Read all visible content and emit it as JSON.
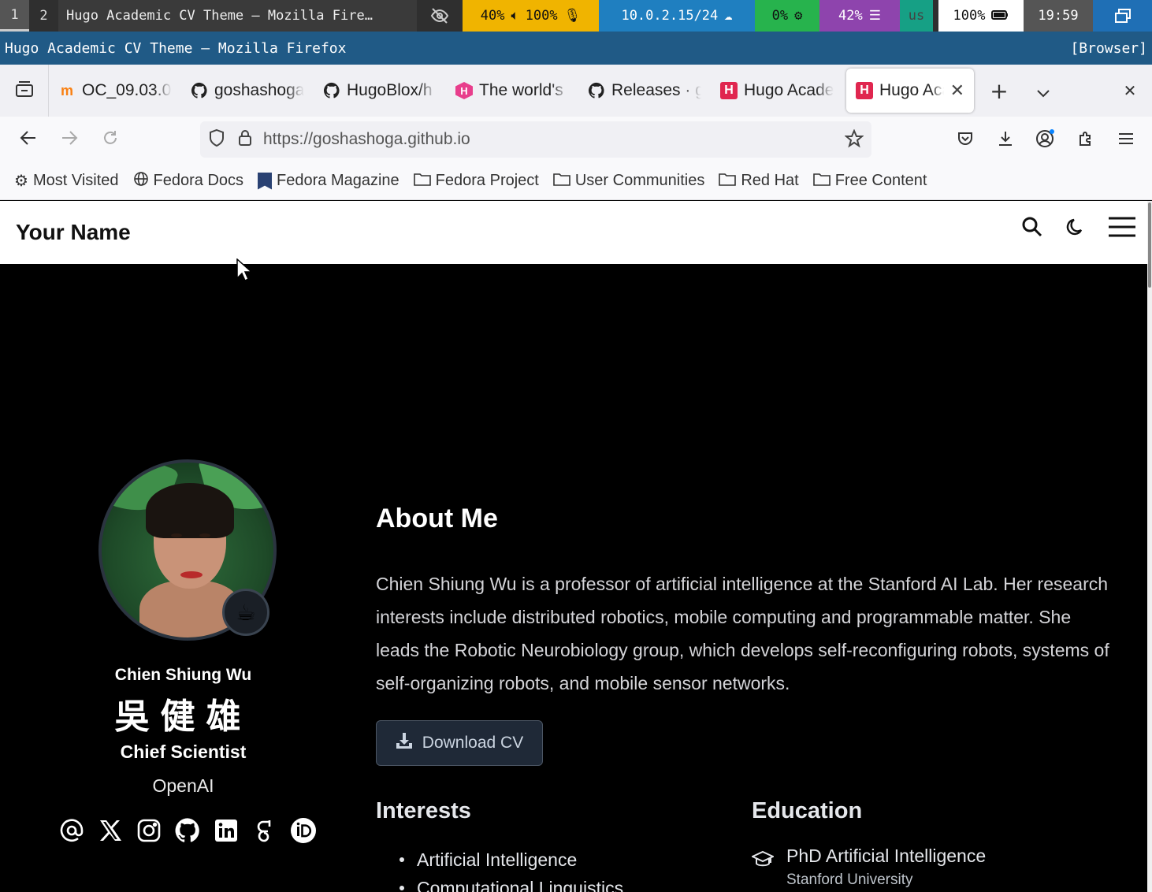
{
  "statusbar": {
    "workspaces": [
      "1",
      "2"
    ],
    "window_title": "Hugo Academic CV Theme — Mozilla Fire…",
    "volume": "40%",
    "mic": "100%",
    "network": "10.0.2.15/24",
    "cpu": "0%",
    "memory": "42%",
    "keyboard": "us",
    "battery": "100%",
    "clock": "19:59"
  },
  "window": {
    "title": "Hugo Academic CV Theme — Mozilla Firefox",
    "tag": "[Browser]"
  },
  "tabs": [
    {
      "label": "OC_09.03.0",
      "icon": "moodle-icon"
    },
    {
      "label": "goshashoga",
      "icon": "github-icon"
    },
    {
      "label": "HugoBlox/h",
      "icon": "github-icon"
    },
    {
      "label": "The world's",
      "icon": "hugoblox-icon"
    },
    {
      "label": "Releases · g",
      "icon": "github-icon"
    },
    {
      "label": "Hugo Acade",
      "icon": "hugo-icon"
    },
    {
      "label": "Hugo Aca",
      "icon": "hugo-icon",
      "active": true
    }
  ],
  "nav": {
    "url": "https://goshashoga.github.io"
  },
  "bookmarks": [
    {
      "label": "Most Visited",
      "icon": "gear-icon"
    },
    {
      "label": "Fedora Docs",
      "icon": "globe-icon"
    },
    {
      "label": "Fedora Magazine",
      "icon": "fedora-magazine-icon"
    },
    {
      "label": "Fedora Project",
      "icon": "folder-icon"
    },
    {
      "label": "User Communities",
      "icon": "folder-icon"
    },
    {
      "label": "Red Hat",
      "icon": "folder-icon"
    },
    {
      "label": "Free Content",
      "icon": "folder-icon"
    }
  ],
  "site": {
    "brand": "Your Name"
  },
  "profile": {
    "name": "Chien Shiung Wu",
    "name_cn": "吳健雄",
    "role": "Chief Scientist",
    "org": "OpenAI",
    "status_emoji": "☕",
    "socials": [
      "email-icon",
      "x-icon",
      "instagram-icon",
      "github-icon",
      "linkedin-icon",
      "google-scholar-icon",
      "orcid-icon"
    ]
  },
  "about": {
    "title": "About Me",
    "text": "Chien Shiung Wu is a professor of artificial intelligence at the Stanford AI Lab. Her research interests include distributed robotics, mobile computing and programmable matter. She leads the Robotic Neurobiology group, which develops self-reconfiguring robots, systems of self-organizing robots, and mobile sensor networks.",
    "cv_button": "Download CV"
  },
  "interests": {
    "title": "Interests",
    "items": [
      "Artificial Intelligence",
      "Computational Linguistics"
    ]
  },
  "education": {
    "title": "Education",
    "items": [
      {
        "degree": "PhD Artificial Intelligence",
        "institution": "Stanford University"
      }
    ]
  }
}
